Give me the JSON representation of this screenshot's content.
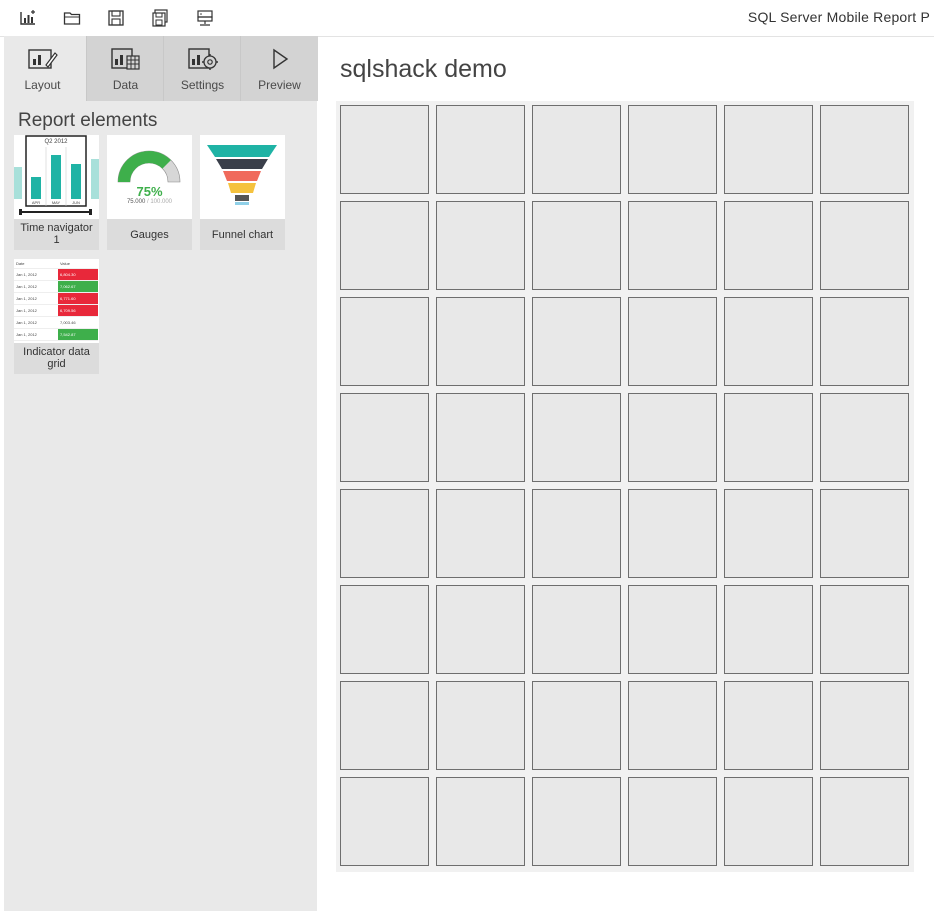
{
  "toolbar": {
    "app_title": "SQL Server Mobile Report P",
    "icons": [
      "new-report-icon",
      "open-folder-icon",
      "save-icon",
      "save-as-icon",
      "publish-server-icon"
    ]
  },
  "tabs": [
    {
      "label": "Layout",
      "icon": "layout-icon",
      "active": true
    },
    {
      "label": "Data",
      "icon": "data-icon",
      "active": false
    },
    {
      "label": "Settings",
      "icon": "settings-icon",
      "active": false
    },
    {
      "label": "Preview",
      "icon": "preview-icon",
      "active": false
    }
  ],
  "sidebar": {
    "heading": "Report elements",
    "elements": [
      {
        "label": "Time navigator 1",
        "thumb": {
          "period": "Q2 2012",
          "months": [
            "APR",
            "MAY",
            "JUN"
          ]
        }
      },
      {
        "label": "Gauges",
        "thumb": {
          "percent": "75%",
          "value": "75.000",
          "target": "/ 100.000",
          "fill_fraction": 0.75
        }
      },
      {
        "label": "Funnel chart",
        "thumb": {
          "colors": [
            "#1fb3a5",
            "#3a3f4a",
            "#f06a5c",
            "#f5c23e",
            "#8fd0e8"
          ]
        }
      },
      {
        "label": "Indicator data grid",
        "thumb": {
          "headers": [
            "Date",
            "Value"
          ],
          "rows": [
            {
              "date": "Jan 1, 2012",
              "value": "6,804.30",
              "status": "red"
            },
            {
              "date": "Jan 1, 2012",
              "value": "7,062.67",
              "status": "green"
            },
            {
              "date": "Jan 1, 2012",
              "value": "6,771.60",
              "status": "red"
            },
            {
              "date": "Jan 1, 2012",
              "value": "6,709.56",
              "status": "red"
            },
            {
              "date": "Jan 1, 2012",
              "value": "7,003.46",
              "status": "none"
            },
            {
              "date": "Jan 1, 2012",
              "value": "7,542.87",
              "status": "green"
            }
          ]
        }
      }
    ]
  },
  "canvas": {
    "title": "sqlshack demo",
    "grid": {
      "columns": 6,
      "rows": 8
    }
  },
  "colors": {
    "accent_green": "#3eaf4b",
    "accent_red": "#e8283a",
    "teal": "#1fb3a5"
  }
}
